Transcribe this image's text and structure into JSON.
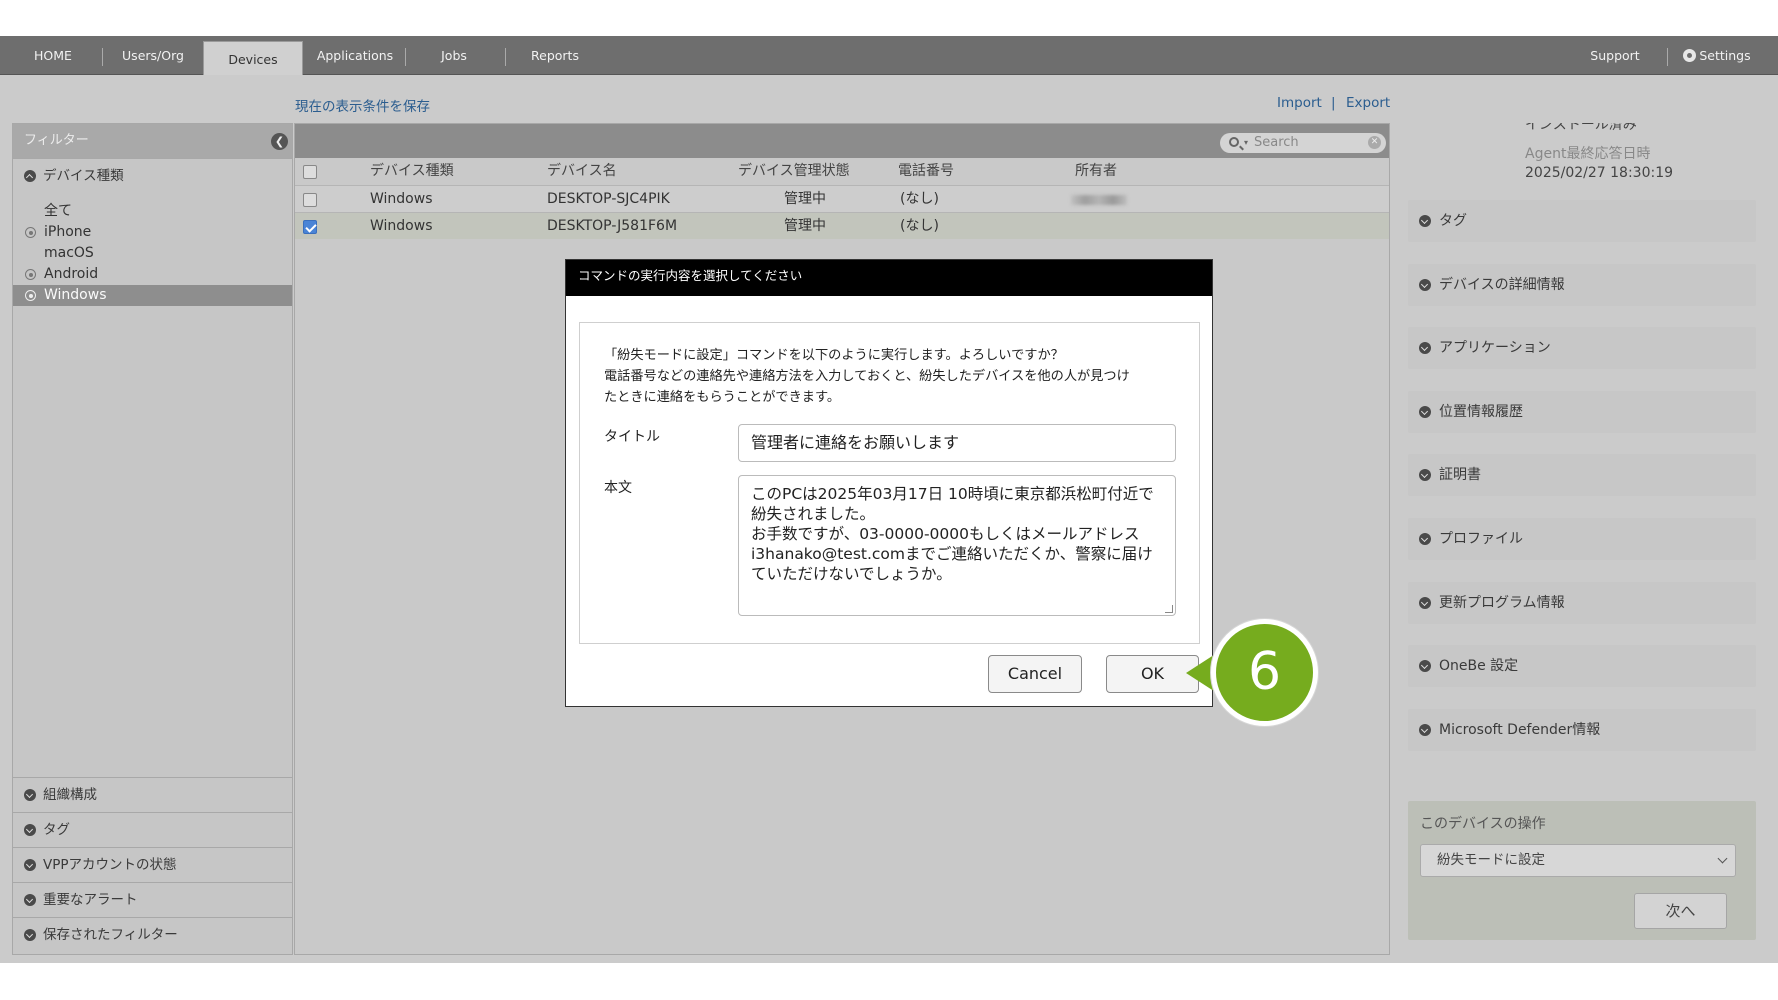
{
  "nav": {
    "home": "HOME",
    "users": "Users/Org",
    "devices": "Devices",
    "applications": "Applications",
    "jobs": "Jobs",
    "reports": "Reports",
    "support": "Support",
    "settings": "Settings"
  },
  "toolbar": {
    "save_filter": "現在の表示条件を保存",
    "import": "Import",
    "separator": "|",
    "export": "Export"
  },
  "filter": {
    "title": "フィルター",
    "device_type_section": "デバイス種類",
    "device_types": [
      "全て",
      "iPhone",
      "macOS",
      "Android",
      "Windows"
    ],
    "selected": "Windows",
    "bottom_sections": [
      "組織構成",
      "タグ",
      "VPPアカウントの状態",
      "重要なアラート",
      "保存されたフィルター"
    ]
  },
  "list": {
    "search_placeholder": "Search",
    "columns": [
      "デバイス種類",
      "デバイス名",
      "デバイス管理状態",
      "電話番号",
      "所有者"
    ],
    "rows": [
      {
        "type": "Windows",
        "name": "DESKTOP-SJC4PIK",
        "status": "管理中",
        "phone": "(なし)",
        "checked": false
      },
      {
        "type": "Windows",
        "name": "DESKTOP-J581F6M",
        "status": "管理中",
        "phone": "(なし)",
        "checked": true
      }
    ]
  },
  "right": {
    "install_status_partial": "インストール済み",
    "agent_label": "Agent最終応答日時",
    "agent_value": "2025/02/27 18:30:19",
    "sections": [
      "タグ",
      "デバイスの詳細情報",
      "アプリケーション",
      "位置情報履歴",
      "証明書",
      "プロファイル",
      "更新プログラム情報",
      "OneBe 設定",
      "Microsoft Defender情報"
    ],
    "ops_title": "このデバイスの操作",
    "ops_selected": "紛失モードに設定",
    "next_button": "次へ"
  },
  "modal": {
    "title": "コマンドの実行内容を選択してください",
    "message_line1": "「紛失モードに設定」コマンドを以下のように実行します。よろしいですか？",
    "message_line2": "電話番号などの連絡先や連絡方法を入力しておくと、紛失したデバイスを他の人が見つけ",
    "message_line3": "たときに連絡をもらうことができます。",
    "title_label": "タイトル",
    "title_value": "管理者に連絡をお願いします",
    "body_label": "本文",
    "body_value": "このPCは2025年03月17日 10時頃に東京都浜松町付近で紛失されました。\nお手数ですが、03-0000-0000もしくはメールアドレスi3hanako@test.comまでご連絡いただくか、警察に届けていただけないでしょうか。",
    "cancel": "Cancel",
    "ok": "OK"
  },
  "callout": {
    "step": "6",
    "color": "#76ac1e"
  }
}
